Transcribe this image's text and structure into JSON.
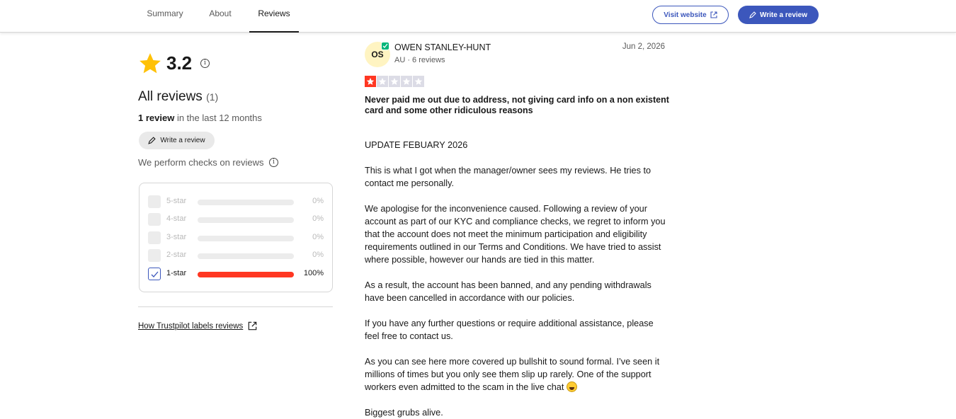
{
  "nav": {
    "tabs": [
      {
        "label": "Summary"
      },
      {
        "label": "About"
      },
      {
        "label": "Reviews"
      }
    ],
    "visit_label": "Visit website",
    "write_label": "Write a review"
  },
  "summary": {
    "rating": "3.2",
    "all_reviews_label": "All reviews",
    "all_reviews_count": "(1)",
    "last12_count": "1 review",
    "last12_text": " in the last 12 months",
    "write_label": "Write a review",
    "checks_label": "We perform checks on reviews",
    "filters": [
      {
        "label": "5-star",
        "percent_text": "0%",
        "percent": 0,
        "checked": false
      },
      {
        "label": "4-star",
        "percent_text": "0%",
        "percent": 0,
        "checked": false
      },
      {
        "label": "3-star",
        "percent_text": "0%",
        "percent": 0,
        "checked": false
      },
      {
        "label": "2-star",
        "percent_text": "0%",
        "percent": 0,
        "checked": false
      },
      {
        "label": "1-star",
        "percent_text": "100%",
        "percent": 100,
        "checked": true
      }
    ],
    "labels_link": "How Trustpilot labels reviews"
  },
  "review": {
    "initials": "OS",
    "name": "OWEN STANLEY-HUNT",
    "meta": "AU · 6 reviews",
    "date": "Jun 2, 2026",
    "stars": 1,
    "title": "Never paid me out due to address, not giving card info on a non existent card and some other ridiculous reasons",
    "paragraphs": [
      "UPDATE FEBUARY 2026",
      "This is what I got when the manager/owner sees my reviews. He tries to contact me personally.",
      "We apologise for the inconvenience caused. Following a review of your account as part of our KYC and compliance checks, we regret to inform you that the account does not meet the minimum participation and eligibility requirements outlined in our Terms and Conditions. We have tried to assist where possible, however our hands are tied in this matter.",
      "As a result, the account has been banned, and any pending withdrawals have been cancelled in accordance with our policies.",
      "If you have any further questions or require additional assistance, please feel free to contact us.",
      "As you can see here more covered up bullshit to sound formal. I’ve seen it millions of times but you only see them slip up rarely. One of the support workers even admitted to the scam in the live chat",
      "Biggest grubs alive."
    ]
  },
  "colors": {
    "accent": "#3c57bc",
    "star_gold": "#ffc107",
    "one_star_red": "#ff3722",
    "verified_green": "#00b67a"
  }
}
